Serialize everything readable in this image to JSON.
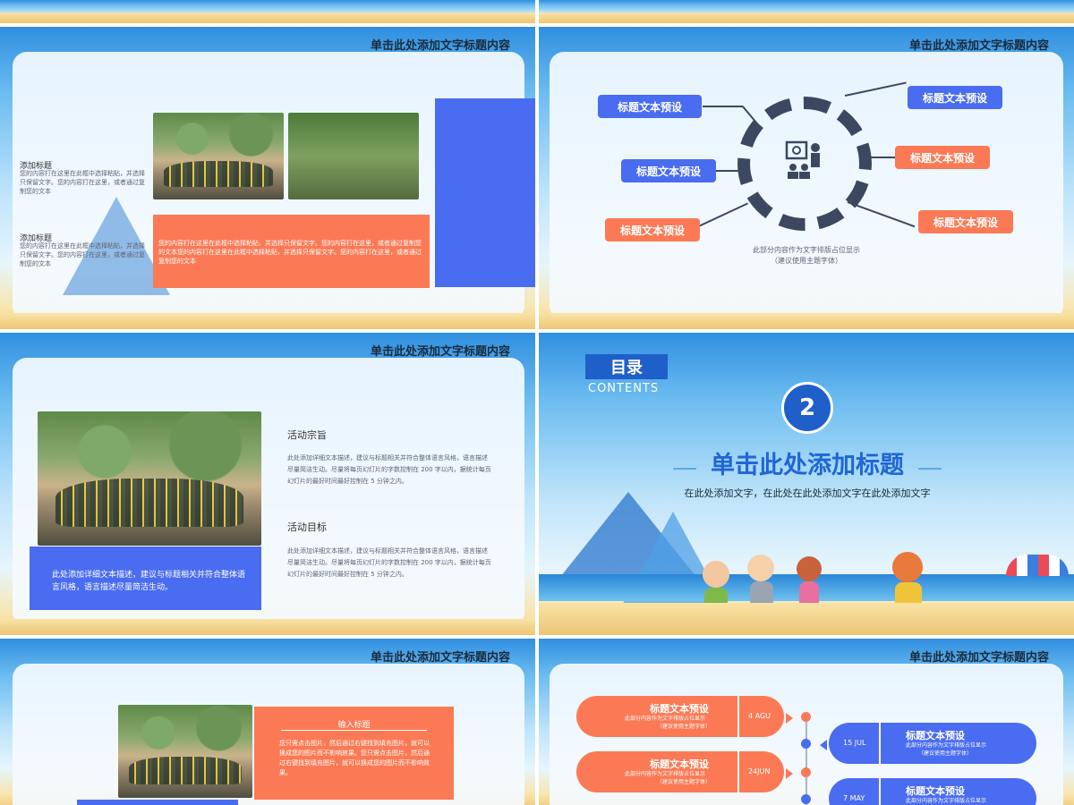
{
  "slide_title": "单击此处添加文字标题内容",
  "slide1": {
    "item1_title": "添加标题",
    "item1_text": "您的内容打在这里在此框中选择粘贴，并选择只保留文字。您的内容打在这里，或者通过复制您的文本",
    "item2_title": "添加标题",
    "item2_text": "您的内容打在这里在此框中选择粘贴，并选择只保留文字。您的内容打在这里，或者通过复制您的文本",
    "orange_text": "您的内容打在这里在此框中选择粘贴，并选择只保留文字。您的内容打在这里，或者通过复制您的文本您的内容打在这里在此框中选择粘贴，并选择只保留文字。您的内容打在这里，或者通过复制您的文本"
  },
  "slide2": {
    "tags": [
      "标题文本预设",
      "标题文本预设",
      "标题文本预设",
      "标题文本预设",
      "标题文本预设",
      "标题文本预设"
    ],
    "note_line1": "此部分内容作为文字排版占位显示",
    "note_line2": "（建议使用主题字体）",
    "colors": {
      "blue": "#4a6cf0",
      "orange": "#fb7a55",
      "ring": "#3b4860"
    },
    "center_icon": "presentation-icon"
  },
  "slide3": {
    "heading1": "活动宗旨",
    "text1": "此处添加详细文本描述，建议与标题相关并符合整体语言风格，语言描述尽量简洁生动。尽量将每页幻灯片的字数控制在 200 字以内，据统计每页幻灯片的最好时间最好控制在 5 分钟之内。",
    "heading2": "活动目标",
    "text2": "此处添加详细文本描述，建议与标题相关并符合整体语言风格，语言描述尽量简洁生动。尽量将每页幻灯片的字数控制在 200 字以内，据统计每页幻灯片的最好时间最好控制在 5 分钟之内。",
    "caption": "此处添加详细文本描述，建议与标题相关并符合整体语言风格，语言描述尽量简洁生动。"
  },
  "slide4": {
    "toc": "目录",
    "contents": "CONTENTS",
    "number": "2",
    "title": "单击此处添加标题",
    "subtitle": "在此处添加文字，在此处在此处添加文字在此处添加文字"
  },
  "slide5": {
    "input_title": "输入标题",
    "text": "您只需点击图片，然后通过右键找到填充图片，就可以换成您的图片而不影响效果。您只需点击图片，然后通过右键找到填充图片，就可以换成您的图片而不影响效果。"
  },
  "slide6": {
    "items": [
      {
        "title": "标题文本预设",
        "desc1": "此部分内容作为文字排版占位显示",
        "desc2": "（建议使用主题字体）",
        "date": "4 AGU"
      },
      {
        "title": "标题文本预设",
        "desc1": "此部分内容作为文字排版占位显示",
        "desc2": "（建议使用主题字体）",
        "date": "15 JUL"
      },
      {
        "title": "标题文本预设",
        "desc1": "此部分内容作为文字排版占位显示",
        "desc2": "（建议使用主题字体）",
        "date": "24JUN"
      },
      {
        "title": "标题文本预设",
        "desc1": "此部分内容作为文字排版占位显示",
        "desc2": "",
        "date": "7 MAY"
      }
    ]
  }
}
